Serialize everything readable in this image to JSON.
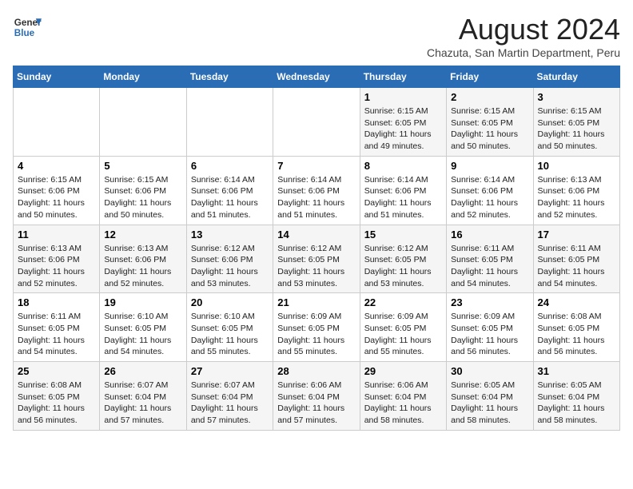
{
  "header": {
    "logo_line1": "General",
    "logo_line2": "Blue",
    "month_year": "August 2024",
    "location": "Chazuta, San Martin Department, Peru"
  },
  "weekdays": [
    "Sunday",
    "Monday",
    "Tuesday",
    "Wednesday",
    "Thursday",
    "Friday",
    "Saturday"
  ],
  "weeks": [
    [
      {
        "day": "",
        "info": ""
      },
      {
        "day": "",
        "info": ""
      },
      {
        "day": "",
        "info": ""
      },
      {
        "day": "",
        "info": ""
      },
      {
        "day": "1",
        "info": "Sunrise: 6:15 AM\nSunset: 6:05 PM\nDaylight: 11 hours\nand 49 minutes."
      },
      {
        "day": "2",
        "info": "Sunrise: 6:15 AM\nSunset: 6:05 PM\nDaylight: 11 hours\nand 50 minutes."
      },
      {
        "day": "3",
        "info": "Sunrise: 6:15 AM\nSunset: 6:05 PM\nDaylight: 11 hours\nand 50 minutes."
      }
    ],
    [
      {
        "day": "4",
        "info": "Sunrise: 6:15 AM\nSunset: 6:06 PM\nDaylight: 11 hours\nand 50 minutes."
      },
      {
        "day": "5",
        "info": "Sunrise: 6:15 AM\nSunset: 6:06 PM\nDaylight: 11 hours\nand 50 minutes."
      },
      {
        "day": "6",
        "info": "Sunrise: 6:14 AM\nSunset: 6:06 PM\nDaylight: 11 hours\nand 51 minutes."
      },
      {
        "day": "7",
        "info": "Sunrise: 6:14 AM\nSunset: 6:06 PM\nDaylight: 11 hours\nand 51 minutes."
      },
      {
        "day": "8",
        "info": "Sunrise: 6:14 AM\nSunset: 6:06 PM\nDaylight: 11 hours\nand 51 minutes."
      },
      {
        "day": "9",
        "info": "Sunrise: 6:14 AM\nSunset: 6:06 PM\nDaylight: 11 hours\nand 52 minutes."
      },
      {
        "day": "10",
        "info": "Sunrise: 6:13 AM\nSunset: 6:06 PM\nDaylight: 11 hours\nand 52 minutes."
      }
    ],
    [
      {
        "day": "11",
        "info": "Sunrise: 6:13 AM\nSunset: 6:06 PM\nDaylight: 11 hours\nand 52 minutes."
      },
      {
        "day": "12",
        "info": "Sunrise: 6:13 AM\nSunset: 6:06 PM\nDaylight: 11 hours\nand 52 minutes."
      },
      {
        "day": "13",
        "info": "Sunrise: 6:12 AM\nSunset: 6:06 PM\nDaylight: 11 hours\nand 53 minutes."
      },
      {
        "day": "14",
        "info": "Sunrise: 6:12 AM\nSunset: 6:05 PM\nDaylight: 11 hours\nand 53 minutes."
      },
      {
        "day": "15",
        "info": "Sunrise: 6:12 AM\nSunset: 6:05 PM\nDaylight: 11 hours\nand 53 minutes."
      },
      {
        "day": "16",
        "info": "Sunrise: 6:11 AM\nSunset: 6:05 PM\nDaylight: 11 hours\nand 54 minutes."
      },
      {
        "day": "17",
        "info": "Sunrise: 6:11 AM\nSunset: 6:05 PM\nDaylight: 11 hours\nand 54 minutes."
      }
    ],
    [
      {
        "day": "18",
        "info": "Sunrise: 6:11 AM\nSunset: 6:05 PM\nDaylight: 11 hours\nand 54 minutes."
      },
      {
        "day": "19",
        "info": "Sunrise: 6:10 AM\nSunset: 6:05 PM\nDaylight: 11 hours\nand 54 minutes."
      },
      {
        "day": "20",
        "info": "Sunrise: 6:10 AM\nSunset: 6:05 PM\nDaylight: 11 hours\nand 55 minutes."
      },
      {
        "day": "21",
        "info": "Sunrise: 6:09 AM\nSunset: 6:05 PM\nDaylight: 11 hours\nand 55 minutes."
      },
      {
        "day": "22",
        "info": "Sunrise: 6:09 AM\nSunset: 6:05 PM\nDaylight: 11 hours\nand 55 minutes."
      },
      {
        "day": "23",
        "info": "Sunrise: 6:09 AM\nSunset: 6:05 PM\nDaylight: 11 hours\nand 56 minutes."
      },
      {
        "day": "24",
        "info": "Sunrise: 6:08 AM\nSunset: 6:05 PM\nDaylight: 11 hours\nand 56 minutes."
      }
    ],
    [
      {
        "day": "25",
        "info": "Sunrise: 6:08 AM\nSunset: 6:05 PM\nDaylight: 11 hours\nand 56 minutes."
      },
      {
        "day": "26",
        "info": "Sunrise: 6:07 AM\nSunset: 6:04 PM\nDaylight: 11 hours\nand 57 minutes."
      },
      {
        "day": "27",
        "info": "Sunrise: 6:07 AM\nSunset: 6:04 PM\nDaylight: 11 hours\nand 57 minutes."
      },
      {
        "day": "28",
        "info": "Sunrise: 6:06 AM\nSunset: 6:04 PM\nDaylight: 11 hours\nand 57 minutes."
      },
      {
        "day": "29",
        "info": "Sunrise: 6:06 AM\nSunset: 6:04 PM\nDaylight: 11 hours\nand 58 minutes."
      },
      {
        "day": "30",
        "info": "Sunrise: 6:05 AM\nSunset: 6:04 PM\nDaylight: 11 hours\nand 58 minutes."
      },
      {
        "day": "31",
        "info": "Sunrise: 6:05 AM\nSunset: 6:04 PM\nDaylight: 11 hours\nand 58 minutes."
      }
    ]
  ]
}
